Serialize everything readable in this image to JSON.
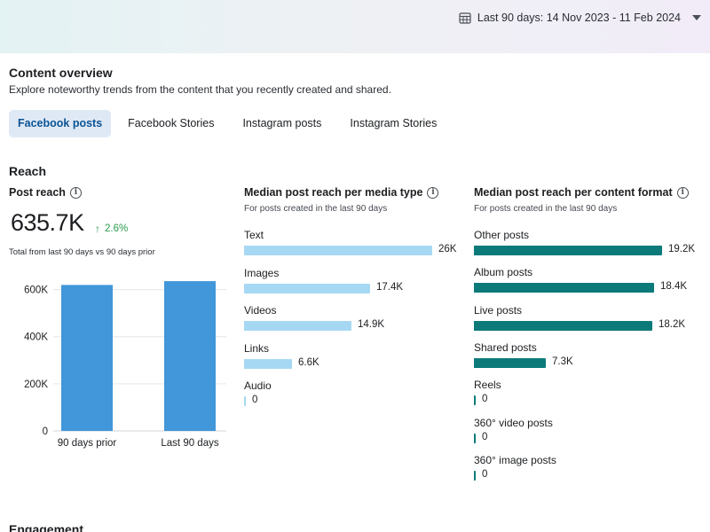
{
  "date_range": {
    "label": "Last 90 days: 14 Nov 2023 - 11 Feb 2024"
  },
  "content_overview": {
    "title": "Content overview",
    "subtitle": "Explore noteworthy trends from the content that you recently created and shared."
  },
  "tabs": [
    {
      "label": "Facebook posts",
      "active": true
    },
    {
      "label": "Facebook Stories",
      "active": false
    },
    {
      "label": "Instagram posts",
      "active": false
    },
    {
      "label": "Instagram Stories",
      "active": false
    }
  ],
  "reach": {
    "heading": "Reach",
    "post_reach": {
      "title": "Post reach",
      "value": "635.7K",
      "delta": "2.6%",
      "note": "Total from last 90 days vs 90 days prior"
    }
  },
  "media_type": {
    "title": "Median post reach per media type",
    "subtitle": "For posts created in the last 90 days"
  },
  "content_format": {
    "title": "Median post reach per content format",
    "subtitle": "For posts created in the last 90 days"
  },
  "engagement": {
    "heading": "Engagement"
  },
  "colors": {
    "column_bar": "#4197d9",
    "media_bar": "#a6d8f4",
    "format_bar": "#0d7a7a",
    "positive": "#2a9d4b"
  },
  "chart_data": [
    {
      "type": "bar",
      "categories": [
        "90 days prior",
        "Last 90 days"
      ],
      "values": [
        619.6,
        635.7
      ],
      "ylabel": "",
      "yticks": [
        "0",
        "200K",
        "400K",
        "600K"
      ],
      "ylim": [
        0,
        700
      ],
      "grid": true
    },
    {
      "type": "bar",
      "orientation": "horizontal",
      "categories": [
        "Text",
        "Images",
        "Videos",
        "Links",
        "Audio"
      ],
      "values": [
        26,
        17.4,
        14.9,
        6.6,
        0
      ],
      "value_labels": [
        "26K",
        "17.4K",
        "14.9K",
        "6.6K",
        "0"
      ]
    },
    {
      "type": "bar",
      "orientation": "horizontal",
      "categories": [
        "Other posts",
        "Album posts",
        "Live posts",
        "Shared posts",
        "Reels",
        "360° video posts",
        "360° image posts"
      ],
      "values": [
        19.2,
        18.4,
        18.2,
        7.3,
        0,
        0,
        0
      ],
      "value_labels": [
        "19.2K",
        "18.4K",
        "18.2K",
        "7.3K",
        "0",
        "0",
        "0"
      ]
    }
  ]
}
